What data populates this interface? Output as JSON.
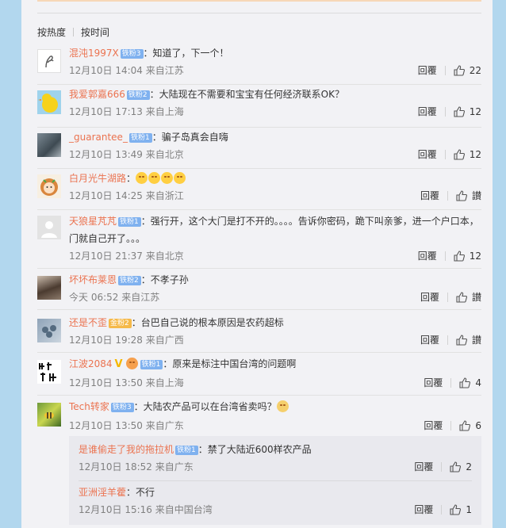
{
  "sort": {
    "hot": "按热度",
    "time": "按时间"
  },
  "actions": {
    "reply": "回覆"
  },
  "colors": {
    "username": "#eb7350",
    "badge": "#7fb1ef",
    "background": "#b2d7ee"
  },
  "comments": [
    {
      "user": "混沌1997X",
      "badge": "铁粉3",
      "text": "：知道了，下一个！",
      "meta": "12月10日 14:04 来自江苏",
      "likes": "22",
      "avatar": "hand-heart-icon"
    },
    {
      "user": "我爱郭嘉666",
      "badge": "铁粉2",
      "text": "：大陆现在不需要和宝宝有任何经济联系OK？",
      "meta": "12月10日 17:13 来自上海",
      "likes": "12",
      "avatar": "yellow-duck-avatar"
    },
    {
      "user": "_guarantee_",
      "badge": "铁粉1",
      "text": "：骗子岛真会自嗨",
      "meta": "12月10日 13:49 来自北京",
      "likes": "12",
      "avatar": "photo-avatar"
    },
    {
      "user": "白月光牛湖路",
      "badge": "",
      "text": "：",
      "meta": "12月10日 14:25 来自浙江",
      "likes": "讃",
      "avatar": "girl-cartoon-avatar"
    },
    {
      "user": "天狼星芃芃",
      "badge": "铁粉1",
      "text": "：强行开，这个大门是打不开的。。。。告诉你密码，跪下叫亲爹，进一个户口本，门就自己开了。。。",
      "meta": "12月10日 21:37 来自北京",
      "likes": "12",
      "avatar": "default-avatar"
    },
    {
      "user": "坏坏布莱恩",
      "badge": "铁粉2",
      "text": "：不孝子孙",
      "meta": "今天 06:52 来自江苏",
      "likes": "讃",
      "avatar": "photo-avatar"
    },
    {
      "user": "还是不歪",
      "badge": "金粉2",
      "text": "：台巴自己说的根本原因是农药超标",
      "meta": "12月10日 19:28 来自广西",
      "likes": "讃",
      "avatar": "flowers-avatar"
    },
    {
      "user": "江波2084",
      "badge": "铁粉1",
      "text": "：原来是标注中国台湾的问题啊",
      "meta": "12月10日 13:50 来自上海",
      "likes": "4",
      "avatar": "calligraphy-avatar"
    },
    {
      "user": "Tech转家",
      "badge": "铁粉3",
      "text": "：大陆农产品可以在台湾省卖吗？",
      "meta": "12月10日 13:50 来自广东",
      "likes": "6",
      "avatar": "bee-avatar"
    }
  ],
  "replies": [
    {
      "user": "是谁偷走了我的拖拉机",
      "badge": "铁粉1",
      "text": "：禁了大陆近600样农产品",
      "meta": "12月10日 18:52 来自广东",
      "likes": "2"
    },
    {
      "user": "亚洲淫羊藿",
      "badge": "",
      "text": "：不行",
      "meta": "12月10日 15:16 来自中国台湾",
      "likes": "1"
    }
  ]
}
